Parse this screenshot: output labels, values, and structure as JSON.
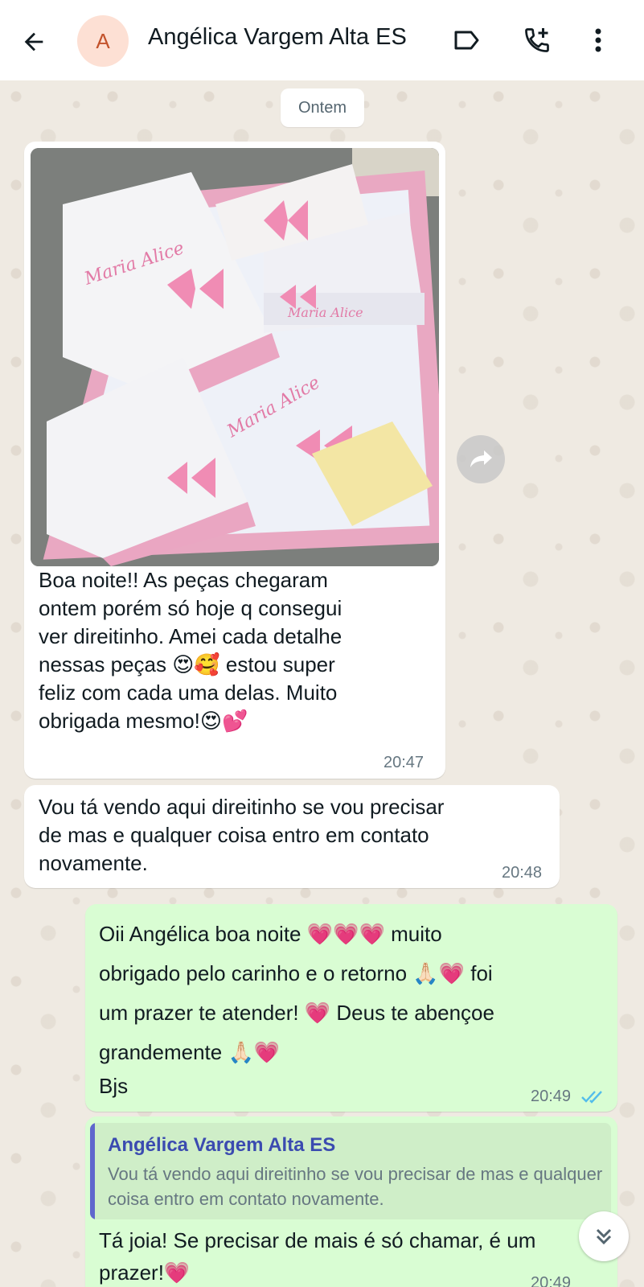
{
  "header": {
    "avatar_letter": "A",
    "contact_name": "Angélica Vargem Alta ES",
    "icons": [
      "back-arrow-icon",
      "label-icon",
      "add-call-icon",
      "more-vert-icon"
    ]
  },
  "date_chip": "Ontem",
  "messages": [
    {
      "direction": "incoming",
      "has_image": true,
      "image_embroidery_text": "Maria Alice",
      "text_lines": [
        "Boa noite!! As peças chegaram",
        "ontem porém só hoje q consegui",
        "ver direitinho. Amei cada detalhe",
        "nessas peças 😍🥰 estou super",
        "feliz com cada uma delas. Muito",
        "obrigada mesmo!😍💕"
      ],
      "time": "20:47"
    },
    {
      "direction": "incoming",
      "text_lines": [
        "Vou tá vendo aqui direitinho se vou precisar",
        "de mas e qualquer coisa entro em contato",
        "novamente."
      ],
      "time": "20:48"
    },
    {
      "direction": "outgoing",
      "text_lines": [
        "Oii Angélica boa noite 💗💗💗 muito",
        "obrigado pelo carinho e o retorno 🙏🏻💗 foi",
        "um prazer te atender! 💗 Deus te abençoe",
        "grandemente 🙏🏻💗",
        "Bjs"
      ],
      "time": "20:49",
      "status": "read"
    },
    {
      "direction": "outgoing",
      "quote": {
        "author": "Angélica Vargem Alta ES",
        "text": "Vou tá vendo aqui direitinho se vou precisar de mas e qualquer coisa entro em contato novamente."
      },
      "text_lines": [
        "Tá joia! Se precisar de mais é só chamar, é um",
        "prazer!💗"
      ],
      "time": "20:49"
    }
  ],
  "colors": {
    "incoming_bubble": "#ffffff",
    "outgoing_bubble": "#d9fdd3",
    "read_ticks": "#53bdeb",
    "quote_bar": "#5f66cd"
  }
}
